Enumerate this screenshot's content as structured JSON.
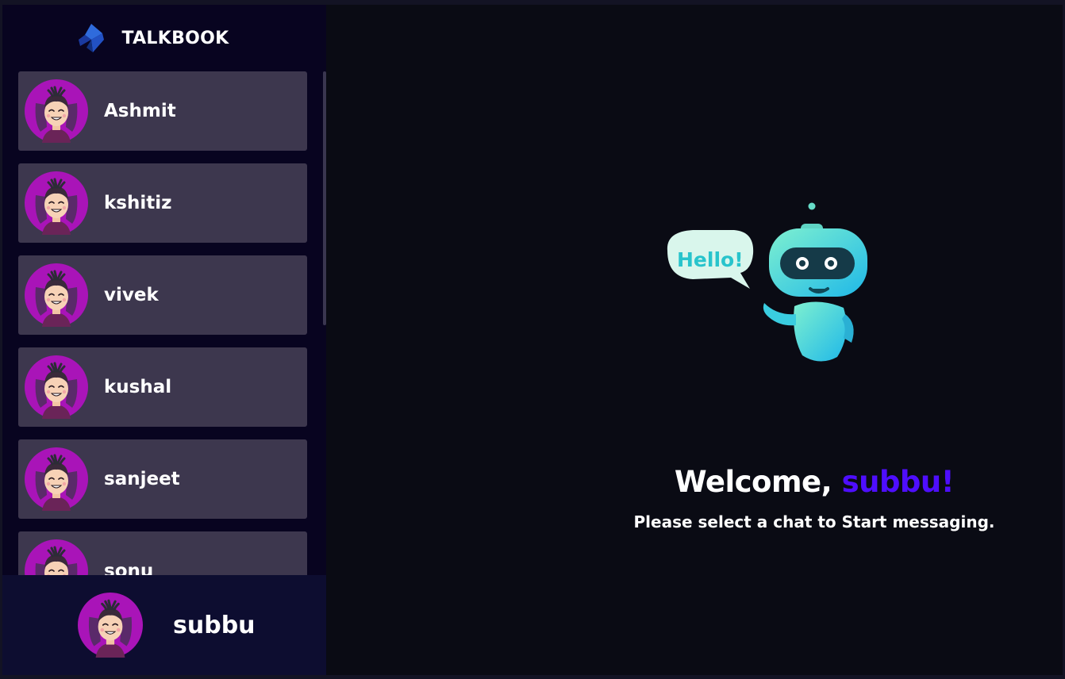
{
  "brand": {
    "name": "TALKBOOK"
  },
  "contacts": [
    {
      "name": "Ashmit"
    },
    {
      "name": "kshitiz"
    },
    {
      "name": "vivek"
    },
    {
      "name": "kushal"
    },
    {
      "name": "sanjeet"
    },
    {
      "name": "sonu"
    }
  ],
  "current_user": {
    "name": "subbu"
  },
  "welcome": {
    "prefix": "Welcome, ",
    "username": "subbu!",
    "subtitle": "Please select a chat to Start messaging."
  },
  "illustration": {
    "bubble_text": "Hello!"
  },
  "colors": {
    "accent": "#4e0eff",
    "sidebar_bg": "#080420",
    "contact_bg": "#3d374e",
    "main_bg": "#0a0b14",
    "avatar_ring": "#b01bc7"
  }
}
